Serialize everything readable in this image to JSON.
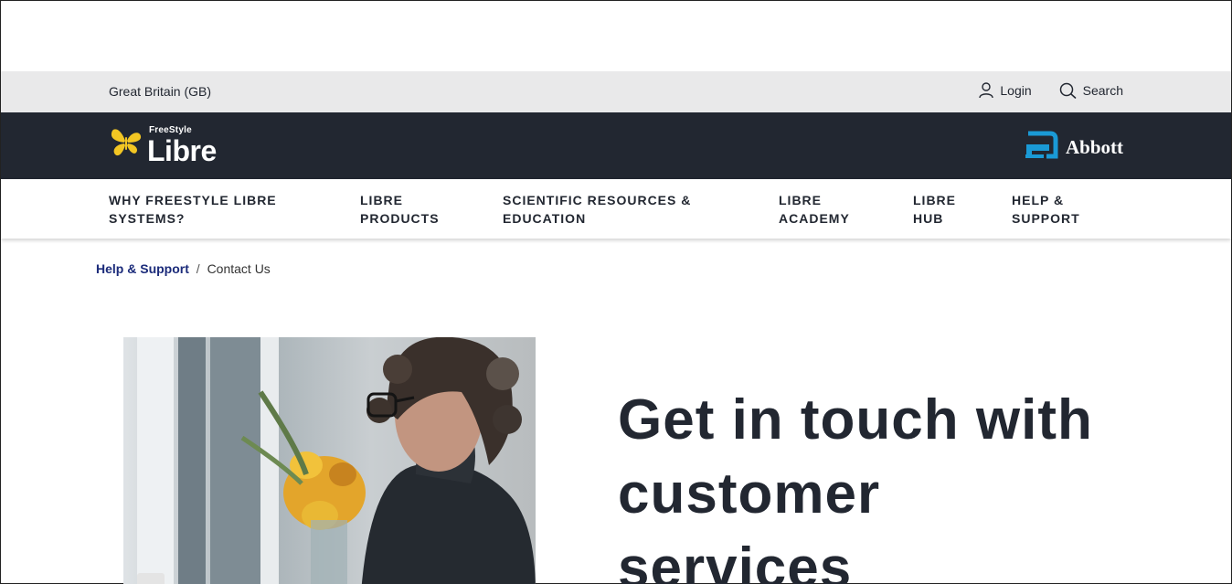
{
  "utility": {
    "region": "Great Britain (GB)",
    "login_label": "Login",
    "search_label": "Search"
  },
  "brand": {
    "product_small": "FreeStyle",
    "product_large": "Libre",
    "company": "Abbott",
    "accent_color": "#f3c623",
    "abbott_blue": "#1a9ad6",
    "bar_color": "#222731"
  },
  "nav": {
    "items": [
      {
        "label": "WHY FREESTYLE LIBRE\nSYSTEMS?"
      },
      {
        "label": "LIBRE\nPRODUCTS"
      },
      {
        "label": "SCIENTIFIC RESOURCES &\nEDUCATION"
      },
      {
        "label": "LIBRE\nACADEMY"
      },
      {
        "label": "LIBRE\nHUB"
      },
      {
        "label": "HELP &\nSUPPORT"
      }
    ]
  },
  "breadcrumb": {
    "parent": "Help & Support",
    "separator": "/",
    "current": "Contact Us"
  },
  "hero": {
    "heading": "Get in touch with customer services",
    "image_alt": "woman with glasses looking at phone"
  },
  "icons": {
    "login": "user-icon",
    "search": "search-icon",
    "brand": "butterfly-icon",
    "abbott": "abbott-logo-icon"
  }
}
